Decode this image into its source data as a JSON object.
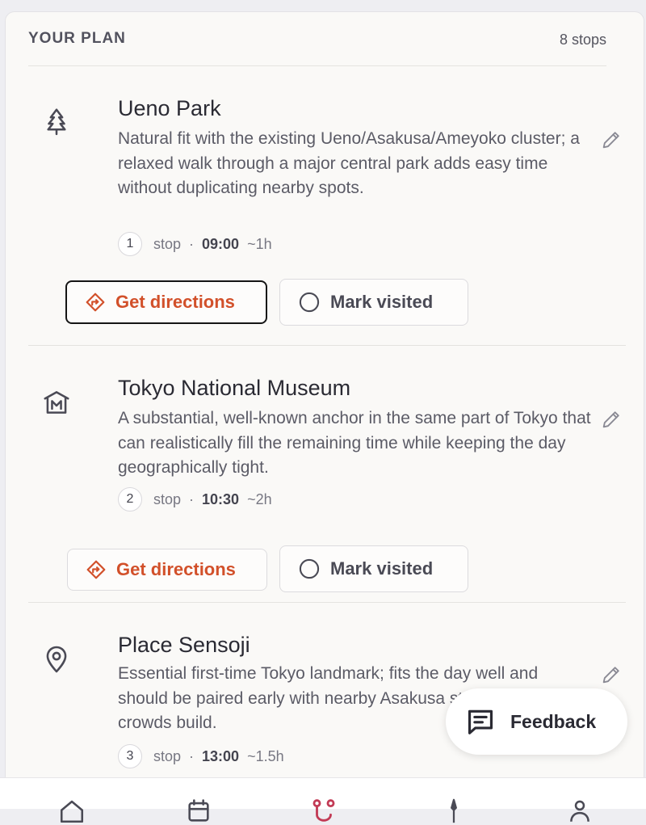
{
  "plan": {
    "title": "YOUR PLAN",
    "count_label": "8 stops"
  },
  "stops": [
    {
      "name": "Ueno Park",
      "description": "Natural fit with the existing Ueno/Asakusa/Ameyoko cluster; a relaxed walk through a major central park adds easy time without duplicating nearby spots.",
      "number": "1",
      "stop_label": "stop",
      "separator": "·",
      "time": "09:00",
      "duration": "~1h",
      "icon": "tree-icon"
    },
    {
      "name": "Tokyo National Museum",
      "description": "A substantial, well-known anchor in the same part of Tokyo that can realistically fill the remaining time while keeping the day geographically tight.",
      "number": "2",
      "stop_label": "stop",
      "separator": "·",
      "time": "10:30",
      "duration": "~2h",
      "icon": "museum-icon"
    },
    {
      "name": "Place Sensoji",
      "description": "Essential first-time Tokyo landmark; fits the day well and should be paired early with nearby Asakusa streets before crowds build.",
      "number": "3",
      "stop_label": "stop",
      "separator": "·",
      "time": "13:00",
      "duration": "~1.5h",
      "icon": "map-pin-icon"
    }
  ],
  "actions": {
    "directions_label": "Get directions",
    "visited_label": "Mark visited"
  },
  "feedback": {
    "label": "Feedback"
  },
  "colors": {
    "accent": "#d2502a",
    "nav_active": "#c23a55",
    "text": "#2a2a33"
  }
}
